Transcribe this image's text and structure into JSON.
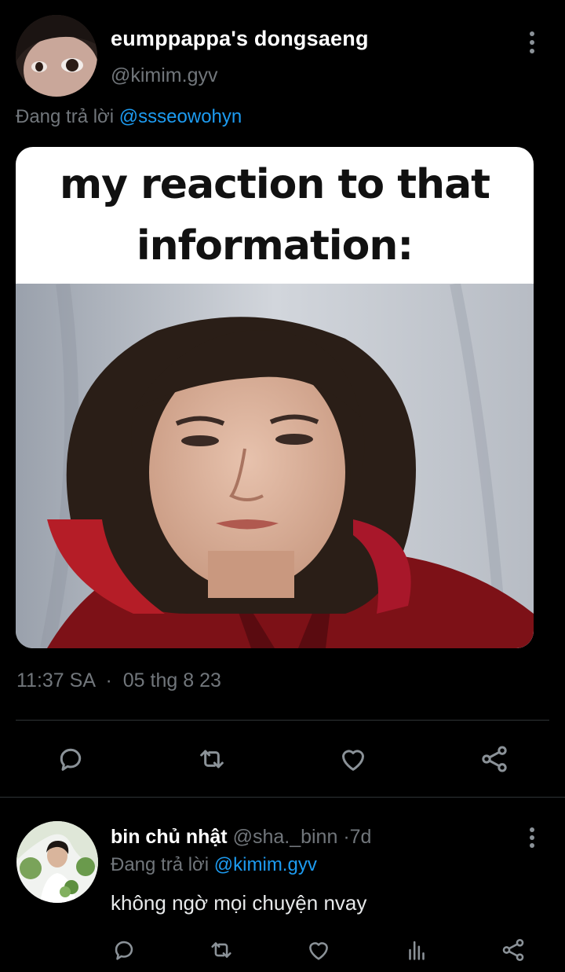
{
  "tweet": {
    "author_name": "eumppappa's dongsaeng",
    "author_handle": "@kimim.gyv",
    "reply_prefix": "Đang trả lời",
    "reply_mention": "@ssseowohyn",
    "meme_caption_line1": "my reaction to that",
    "meme_caption_line2": "information:",
    "time": "11:37 SA",
    "date_sep": "·",
    "date": "05 thg 8 23",
    "icons": {
      "reply": "reply-icon",
      "retweet": "retweet-icon",
      "like": "heart-icon",
      "share": "share-icon",
      "more": "more-vertical-icon"
    }
  },
  "reply_tweet": {
    "author_name": "bin chủ nhật",
    "author_handle": "@sha._binn",
    "age_sep": "·",
    "age": "7d",
    "reply_prefix": "Đang trả lời",
    "reply_mention": "@kimim.gyv",
    "text": "không ngờ mọi chuyện nvay",
    "icons": {
      "reply": "reply-icon",
      "retweet": "retweet-icon",
      "like": "heart-icon",
      "views": "views-icon",
      "share": "share-icon"
    }
  },
  "colors": {
    "background": "#000000",
    "text_primary": "#ffffff",
    "text_secondary": "#71767b",
    "link": "#1d9bf0",
    "divider": "#2f3336"
  }
}
